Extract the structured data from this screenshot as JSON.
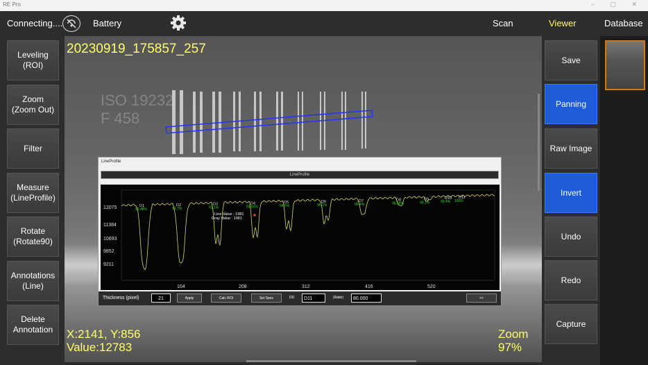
{
  "window": {
    "app_name": "RE Pro",
    "controls": "–  ▢  ✕"
  },
  "topbar": {
    "connecting": "Connecting....",
    "battery": "Battery",
    "tabs": {
      "scan": "Scan",
      "viewer": "Viewer",
      "database": "Database"
    }
  },
  "left_buttons": [
    {
      "label": "Leveling\n(ROI)"
    },
    {
      "label": "Zoom\n(Zoom Out)"
    },
    {
      "label": "Filter"
    },
    {
      "label": "Measure\n(LineProfile)"
    },
    {
      "label": "Rotate\n(Rotate90)"
    },
    {
      "label": "Annotations\n(Line)"
    },
    {
      "label": "Delete\nAnnotation"
    }
  ],
  "right_buttons": [
    {
      "label": "Save",
      "active": false
    },
    {
      "label": "Panning",
      "active": true
    },
    {
      "label": "Raw Image",
      "active": false
    },
    {
      "label": "Invert",
      "active": true
    },
    {
      "label": "Undo",
      "active": false
    },
    {
      "label": "Redo",
      "active": false
    },
    {
      "label": "Capture",
      "active": false
    }
  ],
  "viewer": {
    "filename": "20230919_175857_257",
    "coords": "X:2141, Y:856",
    "value": "Value:12783",
    "zoom_label": "Zoom",
    "zoom_value": "97%",
    "iso_line1": "ISO 19232",
    "iso_line2": "F 458"
  },
  "line_profile": {
    "window_title": "LineProfile",
    "header": "LineProfile",
    "thickness_label": "Thickness (pixel)",
    "thickness_value": "21",
    "apply": "Apply",
    "calc_roi": "Calc ROI",
    "set_spec": "Set Spec",
    "dd_label": "DD",
    "dd_value": "D11",
    "ratio_label": "(Ratio)",
    "ratio_value": "80.000",
    "close": "<<",
    "y_ticks": [
      "12075",
      "11384",
      "10693",
      "9852",
      "9211"
    ],
    "x_ticks": [
      "104",
      "208",
      "312",
      "416",
      "520"
    ],
    "duplex_labels": [
      "D1",
      "D2",
      "D3",
      "D4",
      "D5",
      "D6",
      "D7",
      "D8",
      "D9",
      "D10",
      "D11"
    ],
    "percent_labels": [
      "90.48%",
      "91.7%",
      "92.1%",
      "93.85%",
      "94.5%",
      "95.1%",
      "96.4%",
      "98.38%",
      "99.1%",
      "99.4%",
      "100%"
    ],
    "cursor_text": "Line Value : 1981",
    "cursor_text2": "Gray Value : 1981",
    "colors": {
      "curve": "#d8d860",
      "label": "#33dd33",
      "background": "#050505"
    }
  }
}
